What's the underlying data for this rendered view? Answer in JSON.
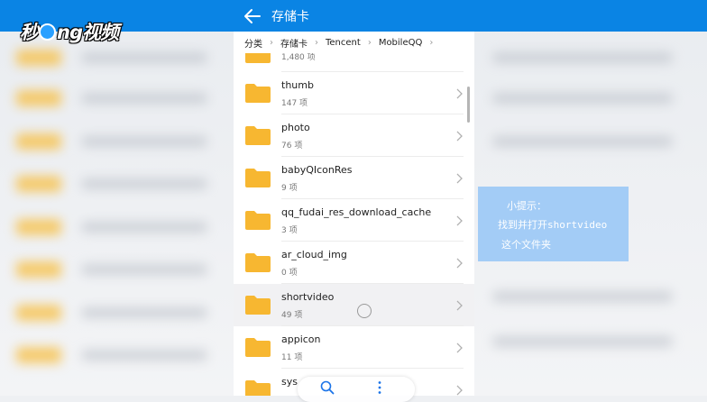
{
  "watermark": {
    "part1": "秒",
    "part2": "ng视频"
  },
  "header": {
    "title": "存储卡"
  },
  "breadcrumb": [
    "分类",
    "存储卡",
    "Tencent",
    "MobileQQ"
  ],
  "folders": [
    {
      "name": "",
      "count": "1,480 项"
    },
    {
      "name": "thumb",
      "count": "147 项"
    },
    {
      "name": "photo",
      "count": "76 项"
    },
    {
      "name": "babyQIconRes",
      "count": "9 项"
    },
    {
      "name": "qq_fudai_res_download_cache",
      "count": "3 项"
    },
    {
      "name": "ar_cloud_img",
      "count": "0 项"
    },
    {
      "name": "shortvideo",
      "count": "49 项"
    },
    {
      "name": "appicon",
      "count": "11 项"
    },
    {
      "name": "sys",
      "count": ""
    }
  ],
  "tip": {
    "line1": "小提示：",
    "line2": "找到并打开shortvideo",
    "line3": "这个文件夹"
  },
  "colors": {
    "header": "#0a84e4",
    "folder": "#f7b731",
    "tip": "#a3ccf6",
    "highlight_row": "#f1f1f3"
  },
  "icons": {
    "back": "back-arrow-icon",
    "folder": "folder-icon",
    "chevron": "chevron-right-icon",
    "search": "search-icon",
    "more": "more-vertical-icon"
  }
}
